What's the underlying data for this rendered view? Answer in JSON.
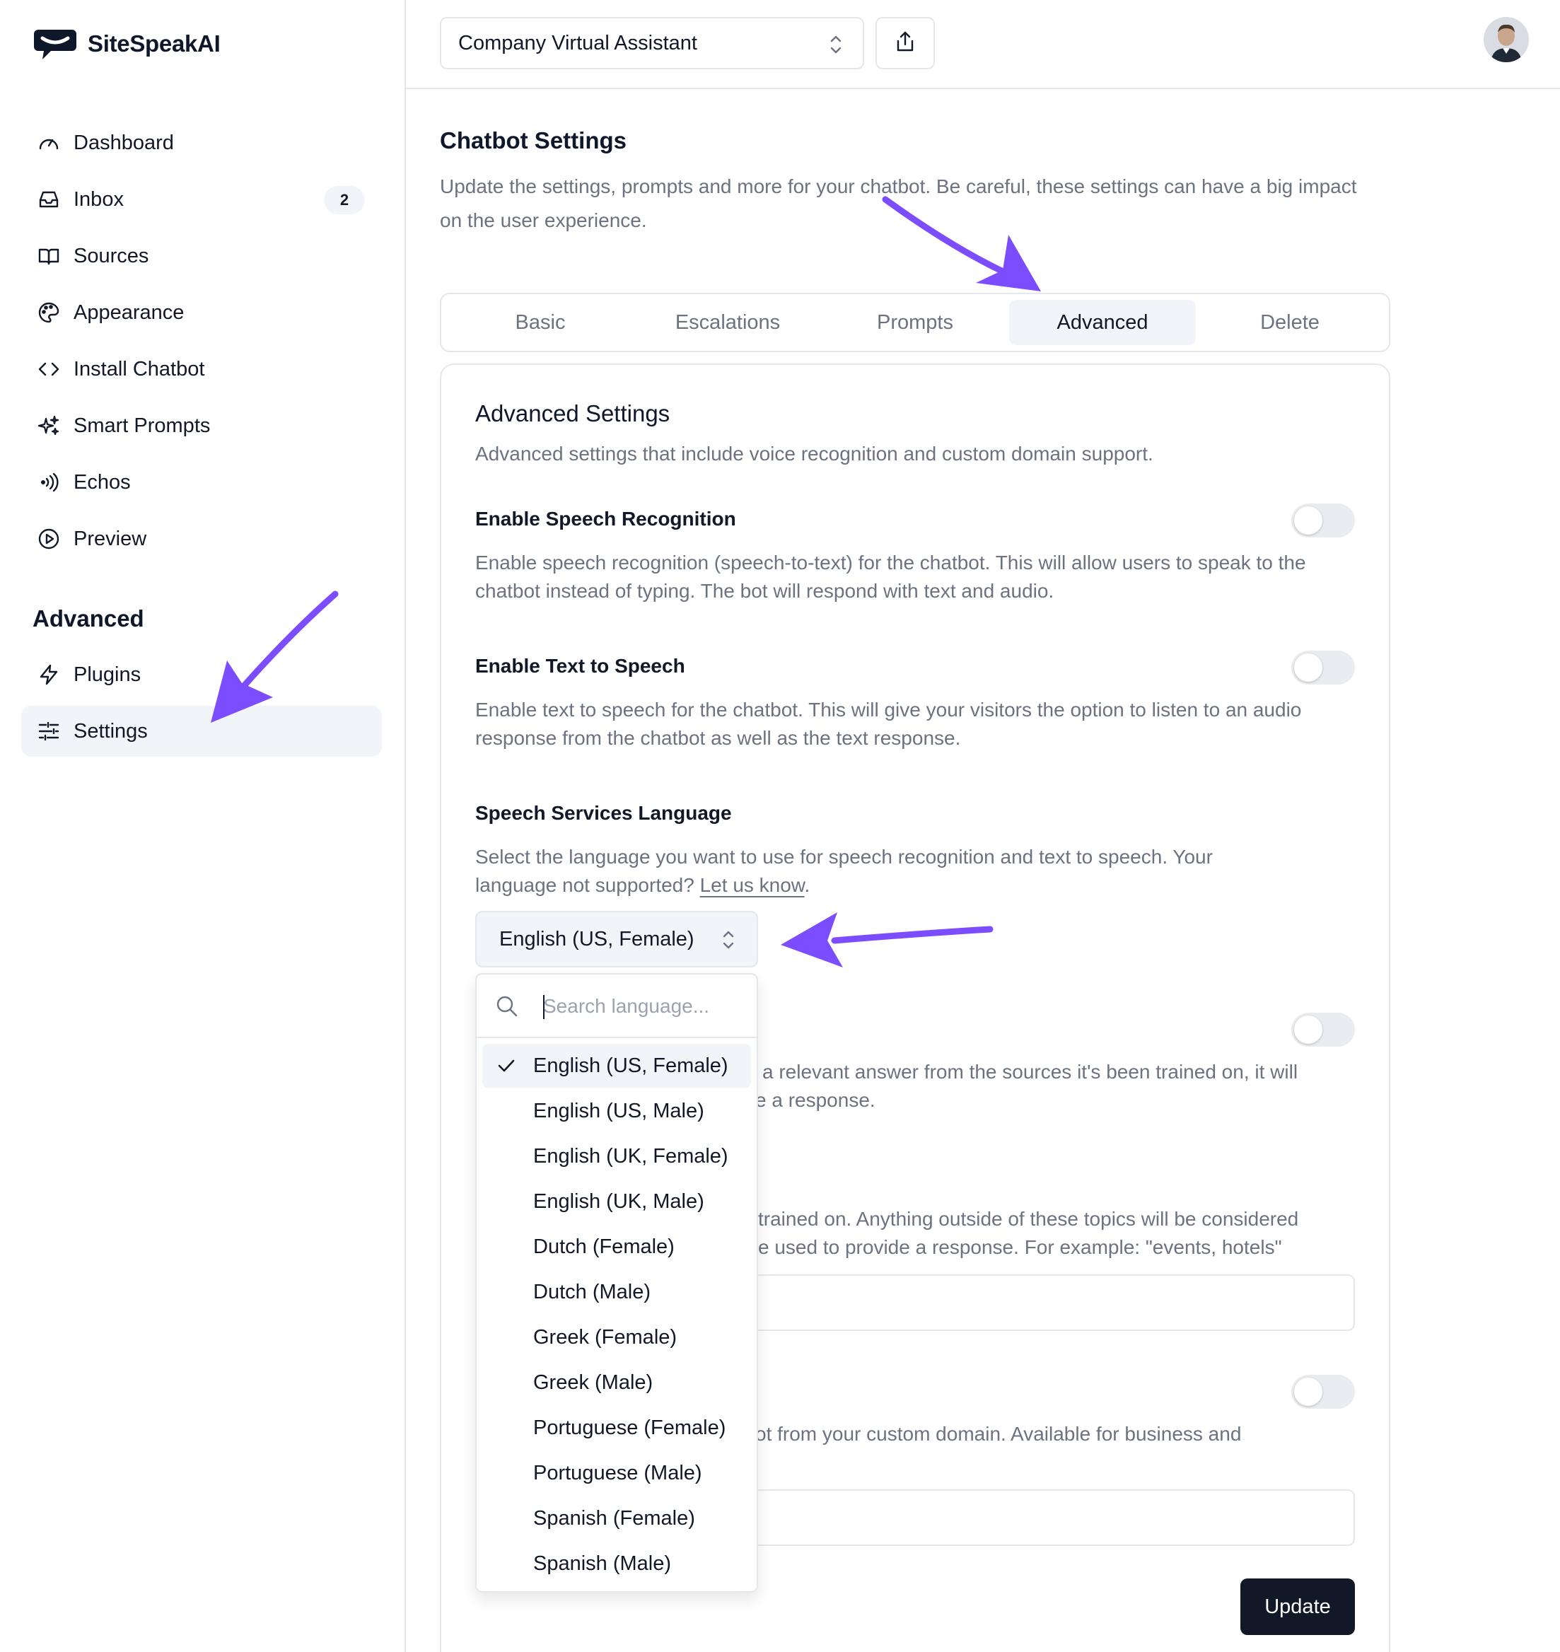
{
  "brand": {
    "name": "SiteSpeakAI"
  },
  "sidebar": {
    "items": [
      {
        "label": "Dashboard",
        "icon": "gauge-icon"
      },
      {
        "label": "Inbox",
        "icon": "inbox-icon",
        "badge": "2"
      },
      {
        "label": "Sources",
        "icon": "book-open-icon"
      },
      {
        "label": "Appearance",
        "icon": "palette-icon"
      },
      {
        "label": "Install Chatbot",
        "icon": "code-icon"
      },
      {
        "label": "Smart Prompts",
        "icon": "sparkles-icon"
      },
      {
        "label": "Echos",
        "icon": "broadcast-icon"
      },
      {
        "label": "Preview",
        "icon": "play-circle-icon"
      }
    ],
    "advanced_heading": "Advanced",
    "advanced_items": [
      {
        "label": "Plugins",
        "icon": "bolt-icon"
      },
      {
        "label": "Settings",
        "icon": "sliders-icon",
        "active": true
      }
    ]
  },
  "topbar": {
    "bot_selector": "Company Virtual Assistant",
    "share_icon": "share-icon",
    "avatar": "user-avatar"
  },
  "page": {
    "title": "Chatbot Settings",
    "description": "Update the settings, prompts and more for your chatbot. Be careful, these settings can have a big impact on the user experience."
  },
  "tabs": [
    {
      "label": "Basic"
    },
    {
      "label": "Escalations"
    },
    {
      "label": "Prompts"
    },
    {
      "label": "Advanced",
      "active": true
    },
    {
      "label": "Delete"
    }
  ],
  "advanced": {
    "title": "Advanced Settings",
    "description": "Advanced settings that include voice recognition and custom domain support.",
    "speech_recognition": {
      "label": "Enable Speech Recognition",
      "description": "Enable speech recognition (speech-to-text) for the chatbot. This will allow users to speak to the chatbot instead of typing. The bot will respond with text and audio.",
      "enabled": false
    },
    "text_to_speech": {
      "label": "Enable Text to Speech",
      "description": "Enable text to speech for the chatbot. This will give your visitors the option to listen to an audio response from the chatbot as well as the text response.",
      "enabled": false
    },
    "language": {
      "label": "Speech Services Language",
      "description": "Select the language you want to use for speech recognition and text to speech. Your language not supported?",
      "link": "Let us know",
      "link_suffix": ".",
      "selected": "English (US, Female)"
    },
    "hidden_setting_1": {
      "desc_line1": "a relevant answer from the sources it's been trained on, it will",
      "desc_line2": "e a response.",
      "enabled": false
    },
    "hidden_setting_2": {
      "desc_line1": "trained on. Anything outside of these topics will be considered",
      "desc_line2": "e used to provide a response. For example: \"events, hotels\""
    },
    "hidden_setting_3": {
      "desc_line1": "ot from your custom domain. Available for business and",
      "enabled": false
    },
    "update_button": "Update"
  },
  "dropdown": {
    "search_placeholder": "Search language...",
    "options": [
      {
        "label": "English (US, Female)",
        "selected": true
      },
      {
        "label": "English (US, Male)"
      },
      {
        "label": "English (UK, Female)"
      },
      {
        "label": "English (UK, Male)"
      },
      {
        "label": "Dutch (Female)"
      },
      {
        "label": "Dutch (Male)"
      },
      {
        "label": "Greek (Female)"
      },
      {
        "label": "Greek (Male)"
      },
      {
        "label": "Portuguese (Female)"
      },
      {
        "label": "Portuguese (Male)"
      },
      {
        "label": "Spanish (Female)"
      },
      {
        "label": "Spanish (Male)"
      }
    ]
  },
  "colors": {
    "annotation_arrow": "#7c4dff",
    "active_bg": "#f1f4f9",
    "button_dark": "#111827",
    "muted_text": "#6b7280",
    "border": "#e5e7eb"
  }
}
